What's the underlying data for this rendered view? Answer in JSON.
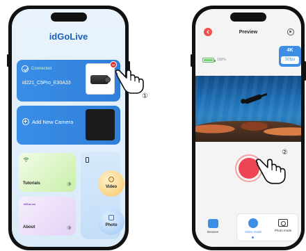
{
  "left_screen": {
    "app_title": "idGoLive",
    "camera_card": {
      "status": "Connected",
      "device_name": "id221_C5Pro_E30A33"
    },
    "add_camera_label": "Add New Camera",
    "tiles": {
      "tutorials": "Tutorials",
      "about": "About",
      "about_logo": "idGoLive"
    },
    "buttons": {
      "video": "Video",
      "photo": "Photo"
    },
    "step_marker": "①"
  },
  "right_screen": {
    "title": "Preview",
    "battery_text": "100%",
    "battery_level": 1.0,
    "resolution": "4K",
    "fps": "30fps",
    "bottom_nav": {
      "devices": "Devices",
      "video_mode": "Video mode",
      "photo_mode": "Photo mode"
    },
    "step_marker": "②"
  },
  "colors": {
    "accent_blue": "#3d8fe6",
    "record_red": "#ee4454",
    "back_red": "#ef5350",
    "connected_green": "#d9f2c0"
  },
  "icons": [
    "check-icon",
    "plus-icon",
    "wifi-icon",
    "phone-icon",
    "video-icon",
    "photo-icon",
    "back-icon",
    "gear-icon",
    "battery-icon",
    "devices-icon",
    "camera-icon",
    "pointing-hand-icon"
  ]
}
